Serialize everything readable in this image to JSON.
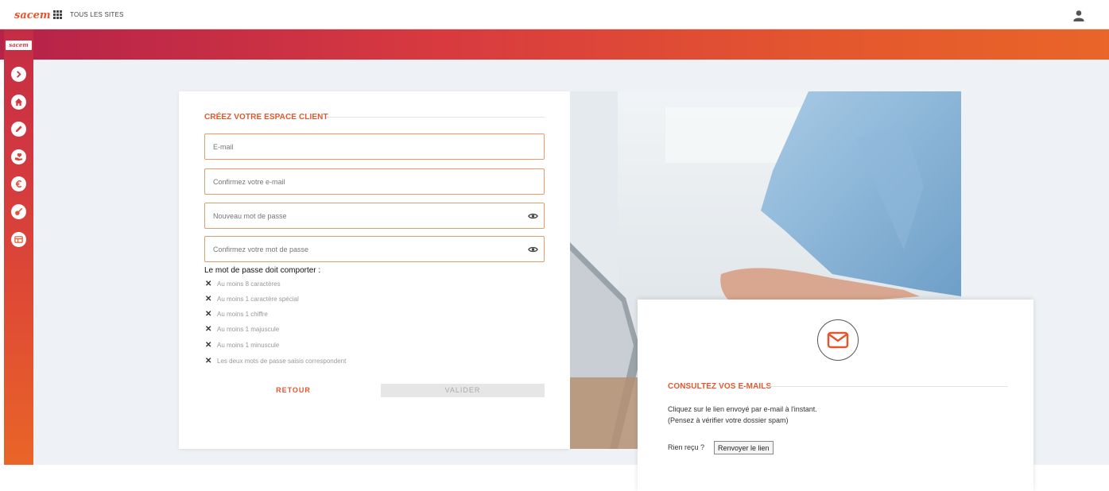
{
  "topbar": {
    "logo": "sacem",
    "sites_label": "TOUS LES SITES"
  },
  "sidebar": {
    "logo": "sacem",
    "items": [
      {
        "name": "expand",
        "icon": "chevron-right-icon"
      },
      {
        "name": "home",
        "icon": "home-icon"
      },
      {
        "name": "edit",
        "icon": "pencil-icon"
      },
      {
        "name": "works",
        "icon": "hand-heart-icon"
      },
      {
        "name": "royalties",
        "icon": "euro-icon"
      },
      {
        "name": "music",
        "icon": "guitar-icon"
      },
      {
        "name": "catalog",
        "icon": "table-icon"
      }
    ]
  },
  "form": {
    "title": "CRÉEZ VOTRE ESPACE CLIENT",
    "email_placeholder": "E-mail",
    "confirm_email_placeholder": "Confirmez votre e-mail",
    "password_placeholder": "Nouveau mot de passe",
    "confirm_password_placeholder": "Confirmez votre mot de passe",
    "rules_title": "Le mot de passe doit comporter :",
    "rules": [
      "Au moins 8 caractères",
      "Au moins 1 caractère spécial",
      "Au moins 1 chiffre",
      "Au moins 1 majuscule",
      "Au moins 1 minuscule",
      "Les deux mots de passe saisis correspondent"
    ],
    "back_label": "RETOUR",
    "submit_label": "VALIDER"
  },
  "popup": {
    "icon": "envelope-icon",
    "title": "CONSULTEZ VOS E-MAILS",
    "line1": "Cliquez sur le lien envoyé par e-mail à l'instant.",
    "line2": "(Pensez à vérifier votre dossier spam)",
    "question": "Rien reçu ?",
    "resend_label": "Renvoyer le lien"
  },
  "colors": {
    "accent": "#e4572e",
    "gradient_start": "#b5224a",
    "gradient_end": "#e96528",
    "background": "#eef1f5"
  }
}
